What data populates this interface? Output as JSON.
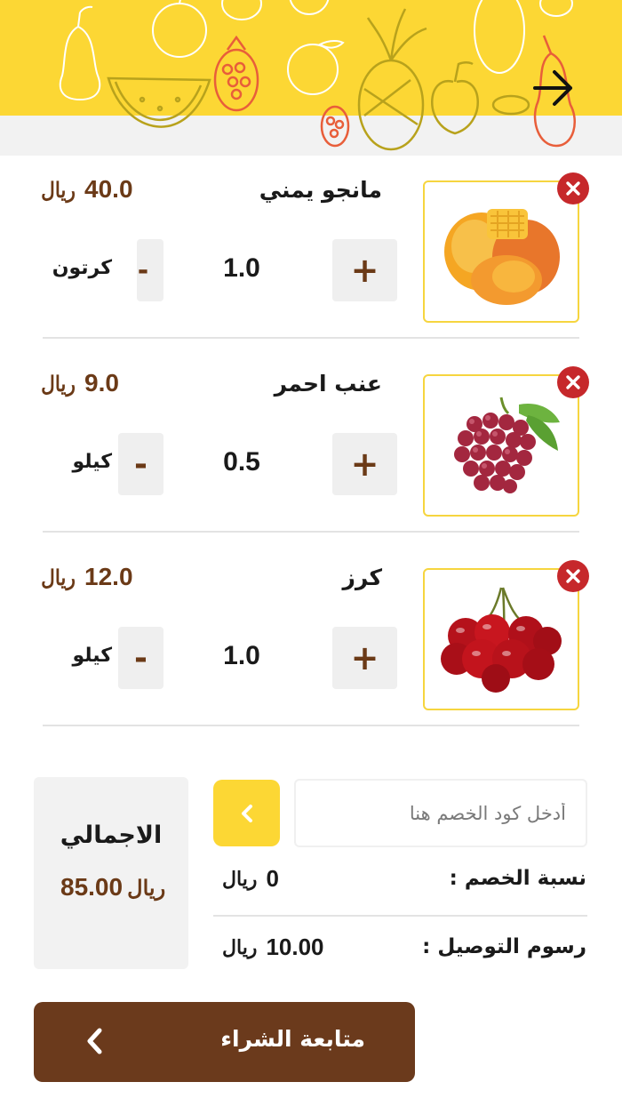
{
  "header": {
    "back_icon": "arrow-right-icon",
    "background_color": "#fcd734"
  },
  "currency_symbol": "ريال",
  "cart_items": [
    {
      "name": "مانجو يمني",
      "price": "40.0",
      "quantity": "1.0",
      "unit": "كرتون",
      "icon": "mango-image"
    },
    {
      "name": "عنب احمر",
      "price": "9.0",
      "quantity": "0.5",
      "unit": "كيلو",
      "icon": "red-grapes-image"
    },
    {
      "name": "كرز",
      "price": "12.0",
      "quantity": "1.0",
      "unit": "كيلو",
      "icon": "cherries-image"
    }
  ],
  "controls": {
    "plus": "+",
    "minus": "-"
  },
  "coupon": {
    "placeholder": "أدخل كود الخصم هنا",
    "apply_icon": "chevron-left-icon"
  },
  "summary": {
    "discount_label": "نسبة الخصم :",
    "discount_value": "0",
    "delivery_label": "رسوم التوصيل :",
    "delivery_value": "10.00",
    "total_label": "الاجمالي",
    "total_value": "85.00"
  },
  "checkout": {
    "label": "متابعة الشراء",
    "icon": "chevron-left-icon"
  },
  "colors": {
    "accent_yellow": "#fcd734",
    "brown": "#6b3a1c",
    "remove_red": "#c6282b"
  }
}
